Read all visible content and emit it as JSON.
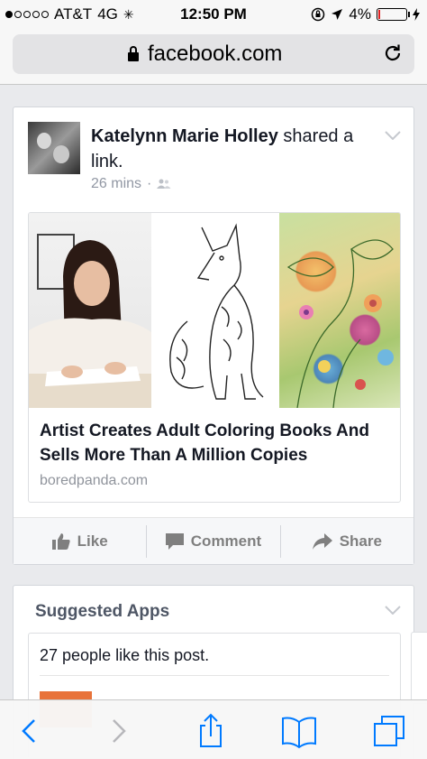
{
  "status_bar": {
    "carrier": "AT&T",
    "network": "4G",
    "time": "12:50 PM",
    "battery": "4%",
    "battery_color": "#e02020"
  },
  "browser": {
    "url": "facebook.com",
    "icons": [
      "lock-icon",
      "reload-icon"
    ]
  },
  "post": {
    "author": "Katelynn Marie Holley",
    "action_text": "shared a link.",
    "time": "26 mins",
    "separator": "·",
    "link": {
      "title": "Artist Creates Adult Coloring Books And Sells More Than A Million Copies",
      "domain": "boredpanda.com"
    },
    "actions": {
      "like": "Like",
      "comment": "Comment",
      "share": "Share"
    }
  },
  "suggested_apps": {
    "title": "Suggested Apps",
    "likes_text": "27 people like this post."
  },
  "toolbar": {
    "icons": [
      "back-icon",
      "forward-icon",
      "share-icon",
      "bookmarks-icon",
      "tabs-icon"
    ]
  },
  "colors": {
    "accent": "#007aff",
    "fb_gray_text": "#9197a3"
  }
}
